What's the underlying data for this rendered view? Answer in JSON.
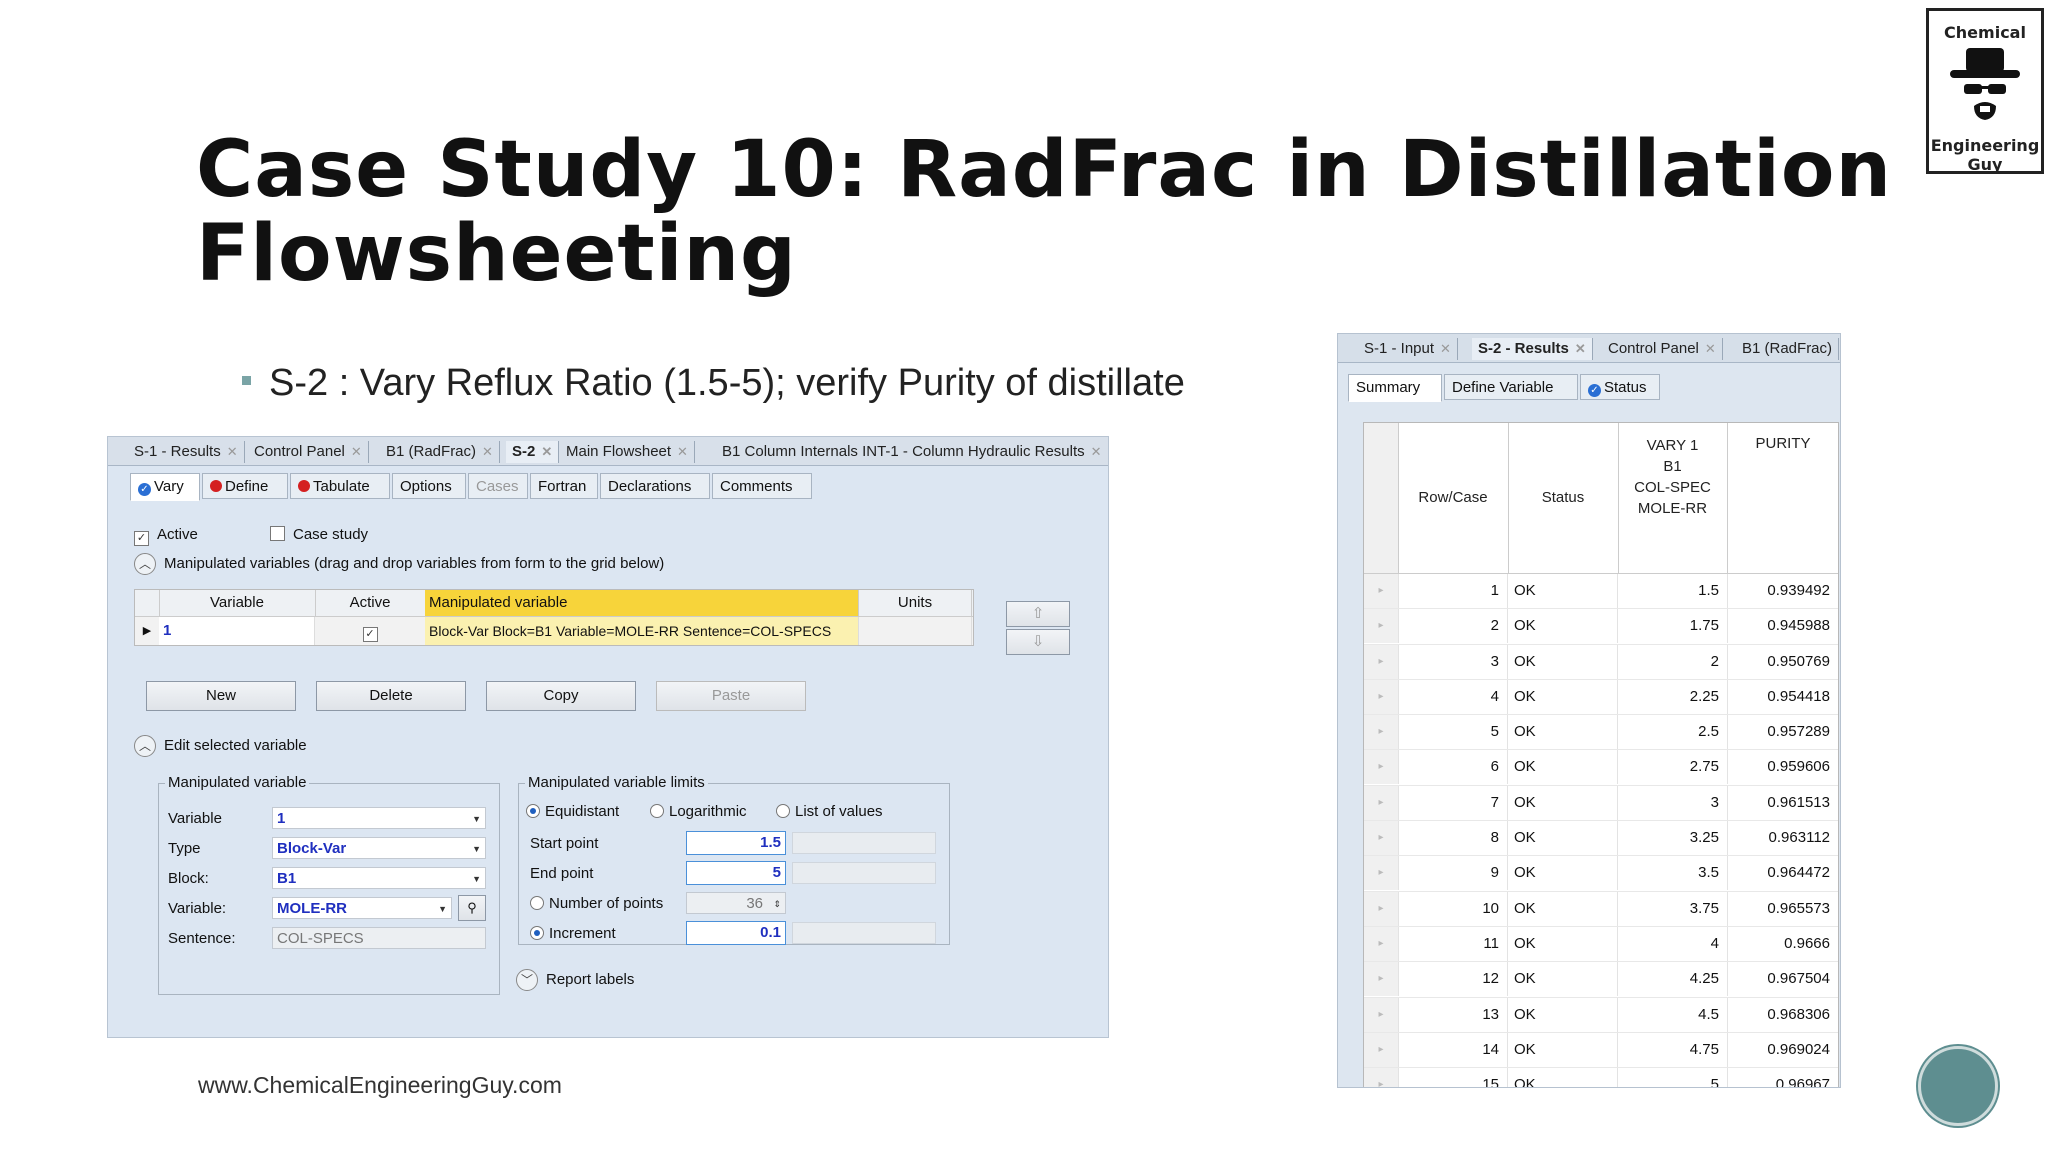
{
  "slide": {
    "title_line1": "Case Study 10: RadFrac in Distillation",
    "title_line2": "Flowsheeting",
    "bullet": "S-2 : Vary Reflux Ratio (1.5-5); verify Purity of distillate",
    "footer_url": "www.ChemicalEngineeringGuy.com",
    "logo_line1": "Chemical",
    "logo_line2": "Engineering Guy",
    "accent_color": "#5e8e90"
  },
  "left_window": {
    "doc_tabs": [
      "S-1 - Results",
      "Control Panel",
      "B1 (RadFrac)",
      "S-2",
      "Main Flowsheet",
      "B1 Column Internals INT-1 - Column Hydraulic Results"
    ],
    "active_doc_tab": "S-2",
    "form_tabs": [
      "Vary",
      "Define",
      "Tabulate",
      "Options",
      "Cases",
      "Fortran",
      "Declarations",
      "Comments"
    ],
    "active_label": "Active",
    "case_study_label": "Case study",
    "manip_section_label": "Manipulated variables (drag and drop variables from form to the grid below)",
    "grid_headers": [
      "Variable",
      "Active",
      "Manipulated variable",
      "Units"
    ],
    "grid_row": {
      "variable": "1",
      "manipulated": "Block-Var Block=B1 Variable=MOLE-RR Sentence=COL-SPECS",
      "units": ""
    },
    "buttons": [
      "New",
      "Delete",
      "Copy",
      "Paste"
    ],
    "edit_section_label": "Edit selected variable",
    "manip_group_label": "Manipulated variable",
    "fields": [
      {
        "label": "Variable",
        "value": "1"
      },
      {
        "label": "Type",
        "value": "Block-Var"
      },
      {
        "label": "Block:",
        "value": "B1"
      },
      {
        "label": "Variable:",
        "value": "MOLE-RR"
      },
      {
        "label": "Sentence:",
        "value": "COL-SPECS"
      }
    ],
    "limits_group_label": "Manipulated variable limits",
    "radio_equidistant": "Equidistant",
    "radio_log": "Logarithmic",
    "radio_list": "List of values",
    "start_label": "Start point",
    "start_value": "1.5",
    "end_label": "End point",
    "end_value": "5",
    "npoints_label": "Number of points",
    "npoints_value": "36",
    "increment_label": "Increment",
    "increment_value": "0.1",
    "report_labels": "Report labels"
  },
  "right_window": {
    "doc_tabs": [
      "S-1 - Input",
      "S-2 - Results",
      "Control Panel",
      "B1 (RadFrac)"
    ],
    "active_doc_tab": "S-2 - Results",
    "sub_tabs": [
      "Summary",
      "Define Variable",
      "Status"
    ],
    "headers": {
      "rowcase": "Row/Case",
      "status": "Status",
      "vary1": "VARY 1",
      "vary2": "B1",
      "vary3": "COL-SPEC",
      "vary4": "MOLE-RR",
      "purity": "PURITY"
    },
    "rows": [
      {
        "case": "1",
        "status": "OK",
        "vary": "1.5",
        "purity": "0.939492"
      },
      {
        "case": "2",
        "status": "OK",
        "vary": "1.75",
        "purity": "0.945988"
      },
      {
        "case": "3",
        "status": "OK",
        "vary": "2",
        "purity": "0.950769"
      },
      {
        "case": "4",
        "status": "OK",
        "vary": "2.25",
        "purity": "0.954418"
      },
      {
        "case": "5",
        "status": "OK",
        "vary": "2.5",
        "purity": "0.957289"
      },
      {
        "case": "6",
        "status": "OK",
        "vary": "2.75",
        "purity": "0.959606"
      },
      {
        "case": "7",
        "status": "OK",
        "vary": "3",
        "purity": "0.961513"
      },
      {
        "case": "8",
        "status": "OK",
        "vary": "3.25",
        "purity": "0.963112"
      },
      {
        "case": "9",
        "status": "OK",
        "vary": "3.5",
        "purity": "0.964472"
      },
      {
        "case": "10",
        "status": "OK",
        "vary": "3.75",
        "purity": "0.965573"
      },
      {
        "case": "11",
        "status": "OK",
        "vary": "4",
        "purity": "0.9666"
      },
      {
        "case": "12",
        "status": "OK",
        "vary": "4.25",
        "purity": "0.967504"
      },
      {
        "case": "13",
        "status": "OK",
        "vary": "4.5",
        "purity": "0.968306"
      },
      {
        "case": "14",
        "status": "OK",
        "vary": "4.75",
        "purity": "0.969024"
      },
      {
        "case": "15",
        "status": "OK",
        "vary": "5",
        "purity": "0.96967"
      }
    ]
  }
}
